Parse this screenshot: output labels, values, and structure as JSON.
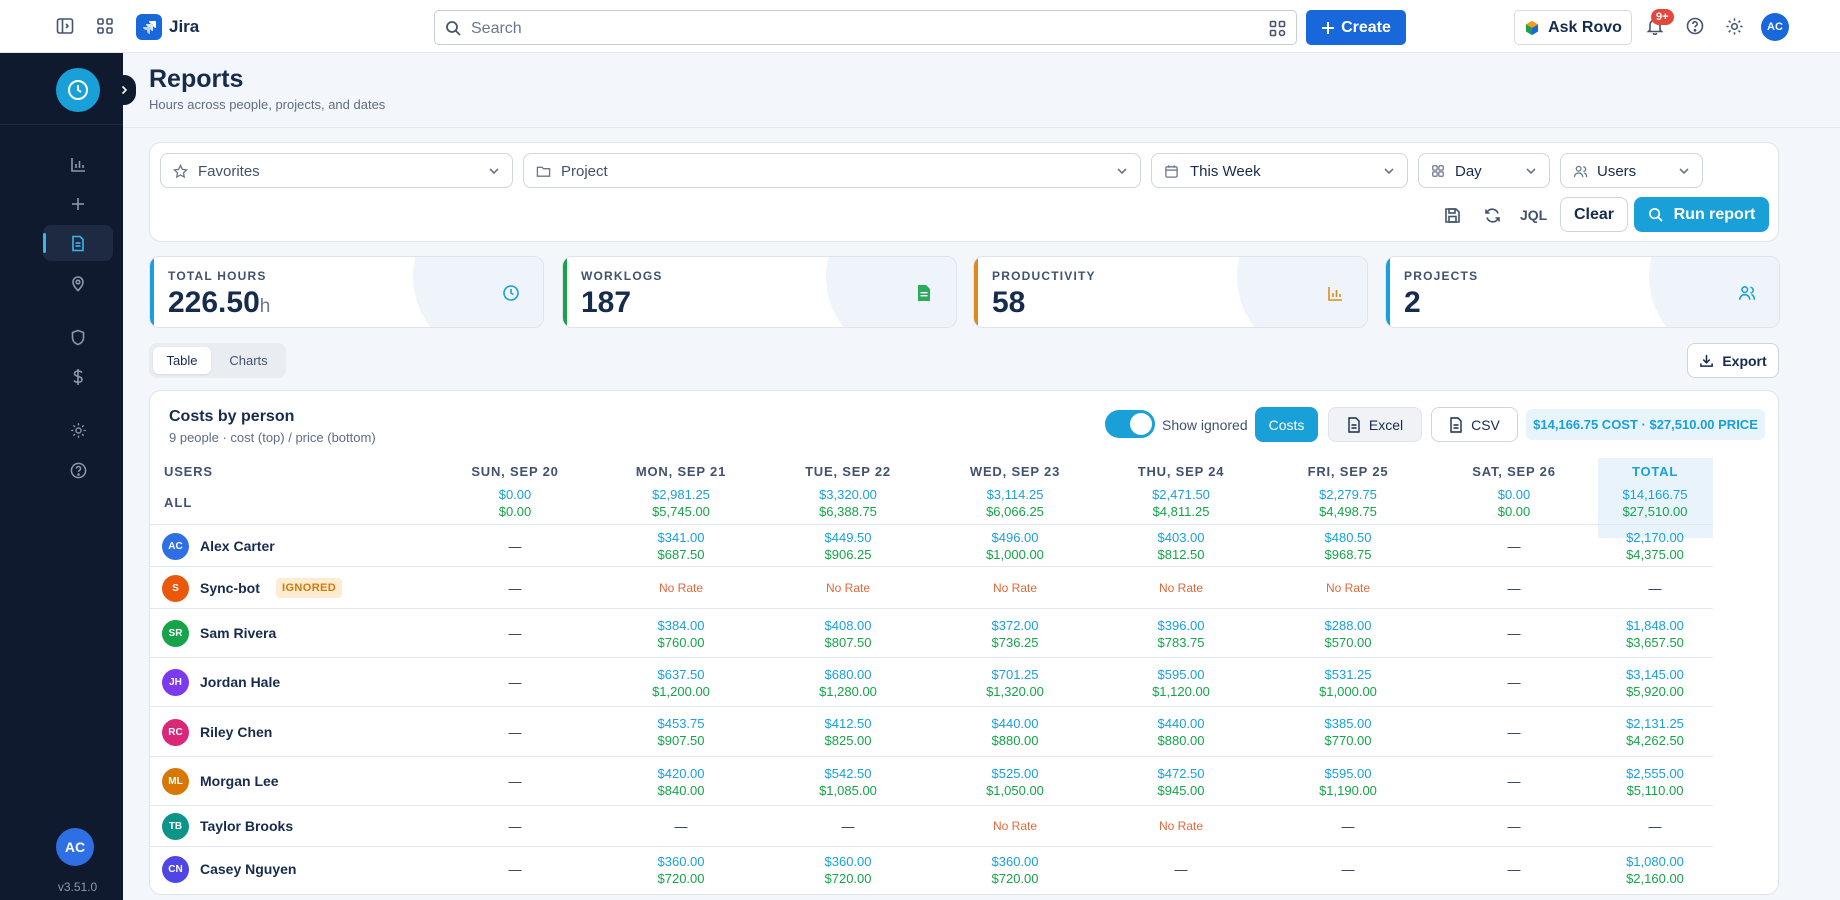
{
  "app": {
    "name": "Jira"
  },
  "topbar": {
    "search_placeholder": "Search",
    "create_label": "Create",
    "rovo_label": "Ask Rovo",
    "notif_count": "9+",
    "user_initials": "AC"
  },
  "sidebar": {
    "user_initials": "AC",
    "version": "v3.51.0"
  },
  "page": {
    "title": "Reports",
    "subtitle": "Hours across people, projects, and dates"
  },
  "filters": {
    "favorites": "Favorites",
    "project": "Project",
    "period": "This Week",
    "granularity": "Day",
    "group": "Users",
    "jql": "JQL",
    "clear": "Clear",
    "run": "Run report"
  },
  "kpis": [
    {
      "label": "TOTAL HOURS",
      "value": "226.50",
      "unit": "h",
      "color": "#1aa0d8"
    },
    {
      "label": "WORKLOGS",
      "value": "187",
      "unit": "",
      "color": "#16a34a"
    },
    {
      "label": "PRODUCTIVITY",
      "value": "58",
      "unit": "",
      "color": "#e08a1e"
    },
    {
      "label": "PROJECTS",
      "value": "2",
      "unit": "",
      "color": "#1aa0d8"
    }
  ],
  "view_tabs": {
    "table": "Table",
    "charts": "Charts",
    "active": "Table"
  },
  "export_label": "Export",
  "panel": {
    "title": "Costs by person",
    "subtitle": "9 people · cost (top) / price (bottom)",
    "show_ignored_label": "Show ignored",
    "costs_label": "Costs",
    "excel_label": "Excel",
    "csv_label": "CSV",
    "summary": "$14,166.75 COST · $27,510.00 PRICE"
  },
  "table": {
    "headers": [
      "USERS",
      "SUN, SEP 20",
      "MON, SEP 21",
      "TUE, SEP 22",
      "WED, SEP 23",
      "THU, SEP 24",
      "FRI, SEP 25",
      "SAT, SEP 26",
      "TOTAL"
    ],
    "all_row": {
      "label": "ALL",
      "cells": [
        [
          "$0.00",
          "$0.00"
        ],
        [
          "$2,981.25",
          "$5,745.00"
        ],
        [
          "$3,320.00",
          "$6,388.75"
        ],
        [
          "$3,114.25",
          "$6,066.25"
        ],
        [
          "$2,471.50",
          "$4,811.25"
        ],
        [
          "$2,279.75",
          "$4,498.75"
        ],
        [
          "$0.00",
          "$0.00"
        ],
        [
          "$14,166.75",
          "$27,510.00"
        ]
      ]
    },
    "ignored_badge": "IGNORED",
    "no_rate": "No Rate",
    "dash": "—",
    "rows": [
      {
        "initials": "AC",
        "name": "Alex Carter",
        "color": "#2f6fe4",
        "cells": [
          "—",
          [
            "$341.00",
            "$687.50"
          ],
          [
            "$449.50",
            "$906.25"
          ],
          [
            "$496.00",
            "$1,000.00"
          ],
          [
            "$403.00",
            "$812.50"
          ],
          [
            "$480.50",
            "$968.75"
          ],
          "—",
          [
            "$2,170.00",
            "$4,375.00"
          ]
        ]
      },
      {
        "initials": "S",
        "name": "Sync-bot",
        "color": "#ea580c",
        "ignored": true,
        "cells": [
          "—",
          "No Rate",
          "No Rate",
          "No Rate",
          "No Rate",
          "No Rate",
          "—",
          "—"
        ]
      },
      {
        "initials": "SR",
        "name": "Sam Rivera",
        "color": "#16a34a",
        "cells": [
          "—",
          [
            "$384.00",
            "$760.00"
          ],
          [
            "$408.00",
            "$807.50"
          ],
          [
            "$372.00",
            "$736.25"
          ],
          [
            "$396.00",
            "$783.75"
          ],
          [
            "$288.00",
            "$570.00"
          ],
          "—",
          [
            "$1,848.00",
            "$3,657.50"
          ]
        ]
      },
      {
        "initials": "JH",
        "name": "Jordan Hale",
        "color": "#7c3aed",
        "cells": [
          "—",
          [
            "$637.50",
            "$1,200.00"
          ],
          [
            "$680.00",
            "$1,280.00"
          ],
          [
            "$701.25",
            "$1,320.00"
          ],
          [
            "$595.00",
            "$1,120.00"
          ],
          [
            "$531.25",
            "$1,000.00"
          ],
          "—",
          [
            "$3,145.00",
            "$5,920.00"
          ]
        ]
      },
      {
        "initials": "RC",
        "name": "Riley Chen",
        "color": "#db2777",
        "cells": [
          "—",
          [
            "$453.75",
            "$907.50"
          ],
          [
            "$412.50",
            "$825.00"
          ],
          [
            "$440.00",
            "$880.00"
          ],
          [
            "$440.00",
            "$880.00"
          ],
          [
            "$385.00",
            "$770.00"
          ],
          "—",
          [
            "$2,131.25",
            "$4,262.50"
          ]
        ]
      },
      {
        "initials": "ML",
        "name": "Morgan Lee",
        "color": "#d97706",
        "cells": [
          "—",
          [
            "$420.00",
            "$840.00"
          ],
          [
            "$542.50",
            "$1,085.00"
          ],
          [
            "$525.00",
            "$1,050.00"
          ],
          [
            "$472.50",
            "$945.00"
          ],
          [
            "$595.00",
            "$1,190.00"
          ],
          "—",
          [
            "$2,555.00",
            "$5,110.00"
          ]
        ]
      },
      {
        "initials": "TB",
        "name": "Taylor Brooks",
        "color": "#0d9488",
        "cells": [
          "—",
          "—",
          "—",
          "No Rate",
          "No Rate",
          "—",
          "—",
          "—"
        ]
      },
      {
        "initials": "CN",
        "name": "Casey Nguyen",
        "color": "#4f46e5",
        "cells": [
          "—",
          [
            "$360.00",
            "$720.00"
          ],
          [
            "$360.00",
            "$720.00"
          ],
          [
            "$360.00",
            "$720.00"
          ],
          "—",
          "—",
          "—",
          [
            "$1,080.00",
            "$2,160.00"
          ]
        ]
      }
    ]
  }
}
